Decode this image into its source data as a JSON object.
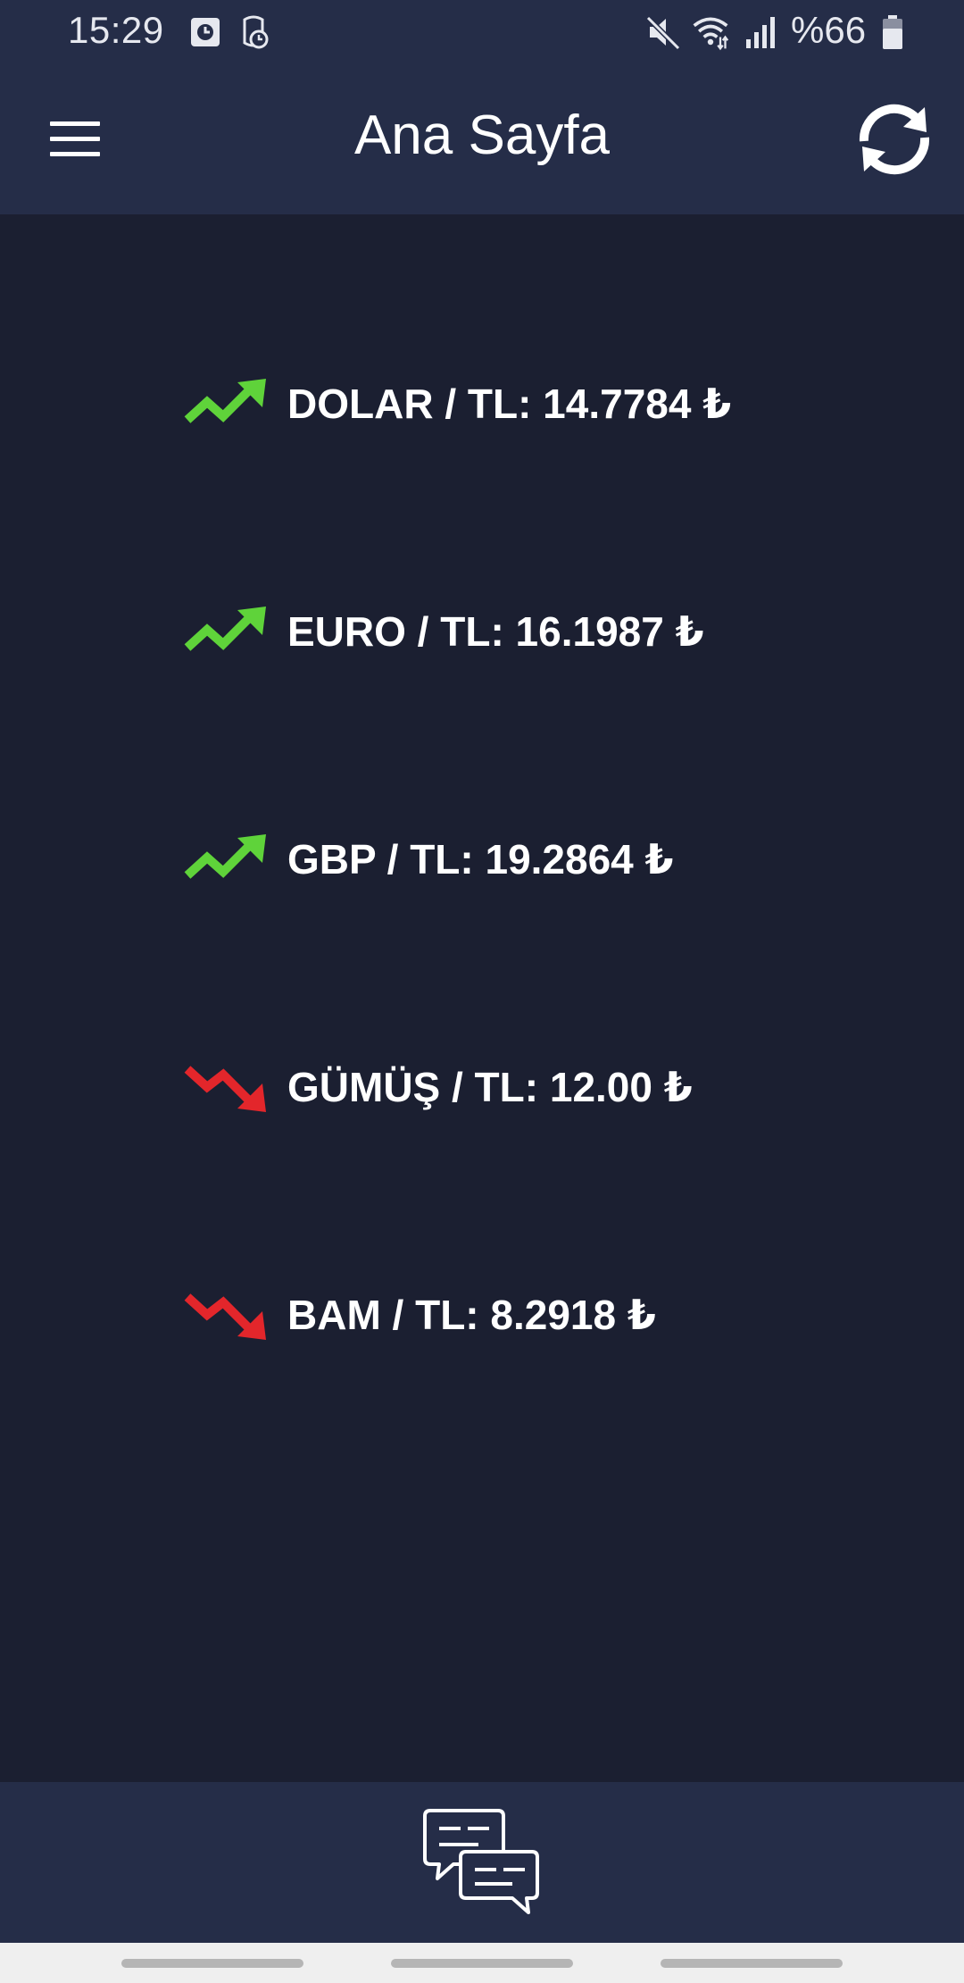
{
  "status_bar": {
    "time": "15:29",
    "battery": "%66",
    "icons": [
      "alarm-icon",
      "watch-icon",
      "mute-icon",
      "wifi-icon",
      "signal-icon",
      "battery-icon"
    ]
  },
  "header": {
    "title": "Ana Sayfa",
    "left_icon": "menu-icon",
    "right_icon": "refresh-icon"
  },
  "rates": [
    {
      "label": "DOLAR / TL: 14.7784 ₺",
      "trend": "up"
    },
    {
      "label": "EURO / TL: 16.1987 ₺",
      "trend": "up"
    },
    {
      "label": "GBP / TL: 19.2864 ₺",
      "trend": "up"
    },
    {
      "label": "GÜMÜŞ / TL: 12.00 ₺",
      "trend": "down"
    },
    {
      "label": "BAM / TL: 8.2918 ₺",
      "trend": "down"
    }
  ],
  "bottom_bar": {
    "icon": "chat-icon"
  },
  "colors": {
    "background": "#1b1f31",
    "bar": "#252d48",
    "trend_up": "#5fd33a",
    "trend_down": "#e3262b",
    "text": "#ffffff"
  }
}
